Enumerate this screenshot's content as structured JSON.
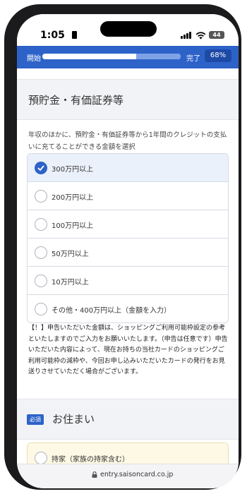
{
  "status": {
    "time": "1:05",
    "battery": "44"
  },
  "progress": {
    "start_label": "開始",
    "end_label": "完了",
    "percent_label": "68%",
    "value": 0.68
  },
  "savings_section": {
    "title": "預貯金・有価証券等",
    "description": "年収のほかに、預貯金・有価証券等から1年間のクレジットの支払いに充てることができる金額を選択",
    "options": [
      {
        "label": "300万円以上",
        "selected": true
      },
      {
        "label": "200万円以上",
        "selected": false
      },
      {
        "label": "100万円以上",
        "selected": false
      },
      {
        "label": "50万円以上",
        "selected": false
      },
      {
        "label": "10万円以上",
        "selected": false
      },
      {
        "label": "その他・400万円以上（金額を入力）",
        "selected": false
      }
    ],
    "note": "【！】申告いただいた金額は、ショッピングご利用可能枠設定の参考といたしますのでご入力をお願いいたします。（申告は任意です）申告いただいた内容によって、現在お持ちの当社カードのショッピングご利用可能枠の減枠や、今回お申し込みいただいたカードの発行をお見送りさせていただく場合がございます。"
  },
  "address_section": {
    "required_badge": "必須",
    "title": "お住まい",
    "first_option": "持家（家族の持家含む）"
  },
  "browser": {
    "url": "entry.saisoncard.co.jp"
  },
  "colors": {
    "accent": "#2d63c9",
    "selected_bg": "#ebf1fb",
    "highlight_bg": "#fdf9e4"
  }
}
